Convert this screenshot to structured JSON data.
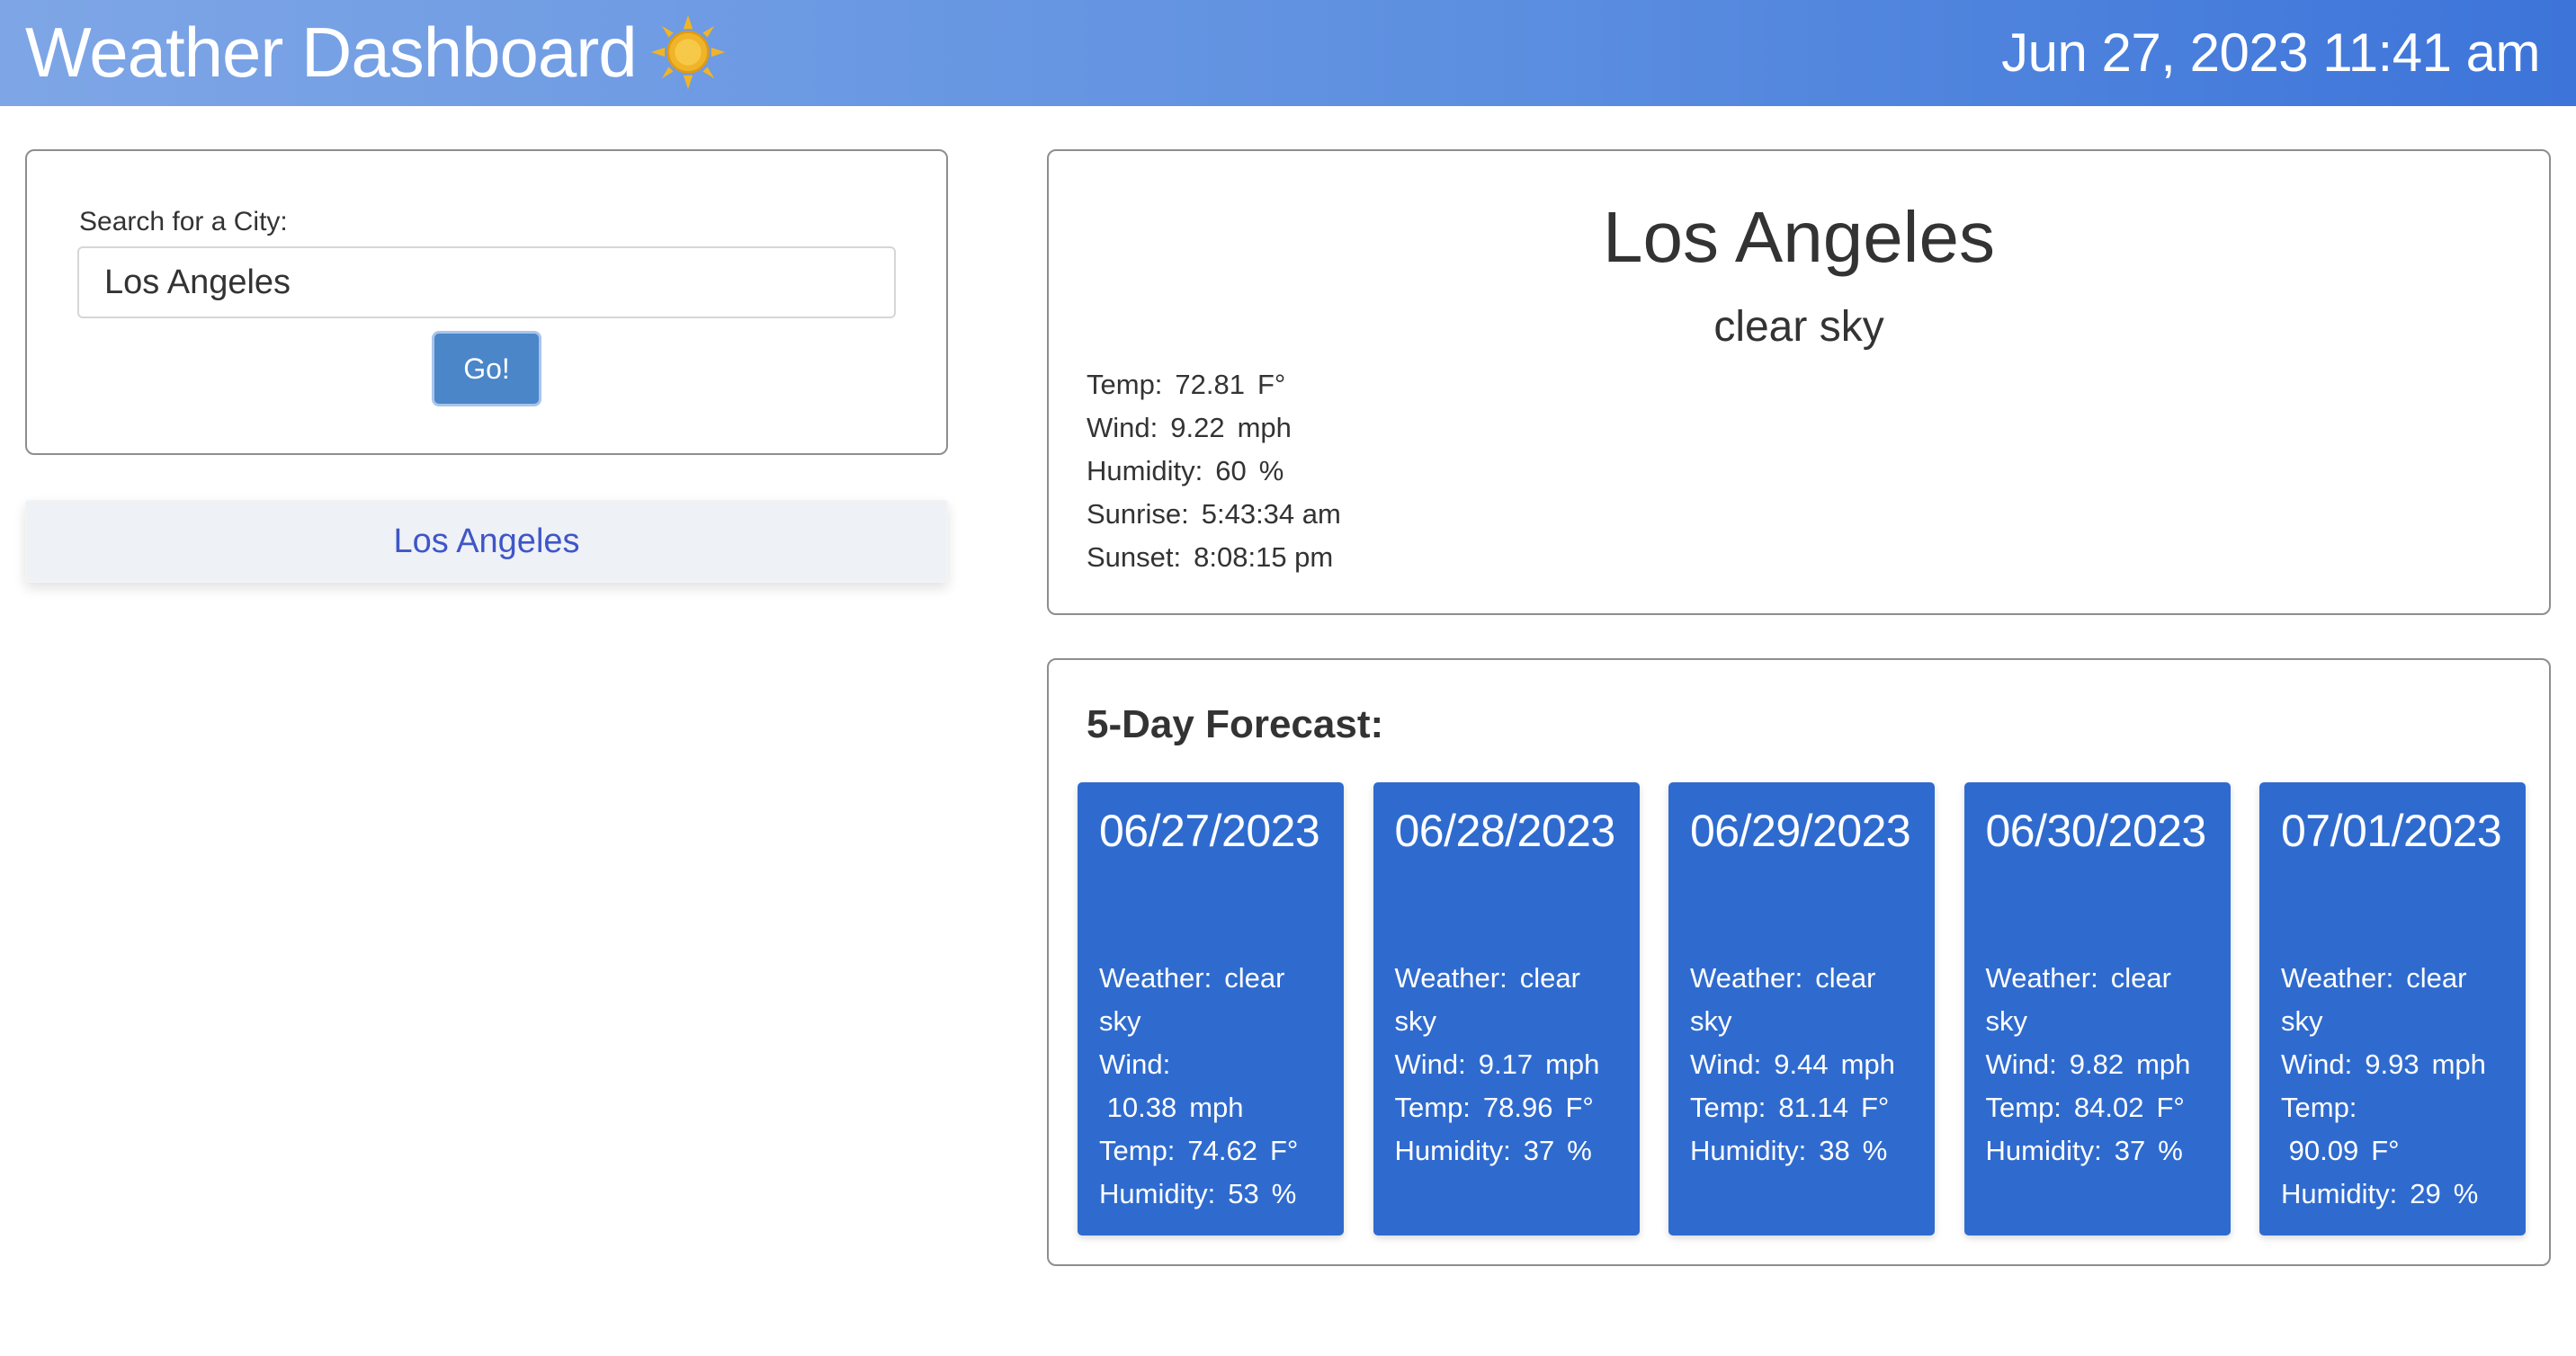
{
  "header": {
    "title": "Weather Dashboard",
    "datetime": "Jun 27, 2023 11:41 am",
    "icon": "sun-icon"
  },
  "search": {
    "label": "Search for a City:",
    "value": "Los Angeles",
    "button_label": "Go!"
  },
  "history": [
    {
      "city": "Los Angeles"
    }
  ],
  "current": {
    "city": "Los Angeles",
    "description": "clear sky",
    "temp_label": "Temp:",
    "temp_value": "72.81",
    "temp_unit": "F°",
    "wind_label": "Wind:",
    "wind_value": "9.22",
    "wind_unit": "mph",
    "humidity_label": "Humidity:",
    "humidity_value": "60",
    "humidity_unit": "%",
    "sunrise_label": "Sunrise:",
    "sunrise_value": "5:43:34 am",
    "sunset_label": "Sunset:",
    "sunset_value": "8:08:15 pm"
  },
  "forecast": {
    "title": "5-Day Forecast:",
    "days": [
      {
        "date": "06/27/2023",
        "weather": "clear sky",
        "wind": "10.38",
        "temp": "74.62",
        "humidity": "53"
      },
      {
        "date": "06/28/2023",
        "weather": "clear sky",
        "wind": "9.17",
        "temp": "78.96",
        "humidity": "37"
      },
      {
        "date": "06/29/2023",
        "weather": "clear sky",
        "wind": "9.44",
        "temp": "81.14",
        "humidity": "38"
      },
      {
        "date": "06/30/2023",
        "weather": "clear sky",
        "wind": "9.82",
        "temp": "84.02",
        "humidity": "37"
      },
      {
        "date": "07/01/2023",
        "weather": "clear sky",
        "wind": "9.93",
        "temp": "90.09",
        "humidity": "29"
      }
    ],
    "weather_label": "Weather:",
    "wind_label": "Wind:",
    "temp_label": "Temp:",
    "humidity_label": "Humidity:",
    "wind_unit": "mph",
    "temp_unit": "F°",
    "humidity_unit": "%"
  },
  "colors": {
    "header_start": "#7ea6e6",
    "header_end": "#3d74d9",
    "forecast_card": "#2f6bcf",
    "go_button": "#4a86c8",
    "history_text": "#3f56c8",
    "sun": "#f0b429"
  }
}
